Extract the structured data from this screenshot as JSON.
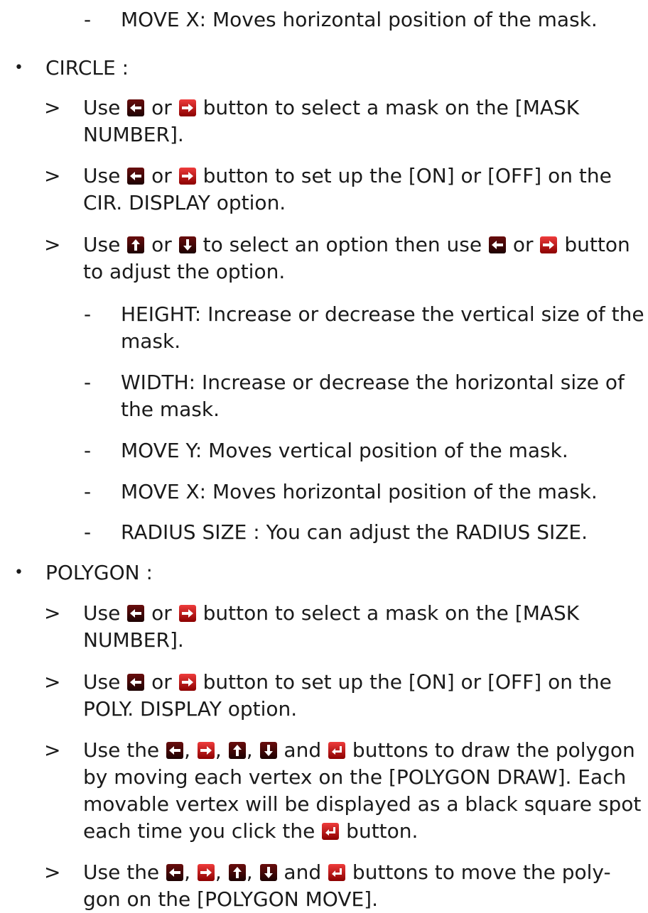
{
  "markers": {
    "bullet": "•",
    "arrow": ">",
    "dash": "-"
  },
  "lines": [
    {
      "text": "MOVE X: Moves horizontal position of the mask."
    },
    {
      "text": "CIRCLE :"
    },
    {
      "text": "button to select a mask on the [MASK"
    },
    {
      "text": "NUMBER]."
    },
    {
      "text": "button to set up the [ON] or [OFF] on the"
    },
    {
      "text": "CIR. DISPLAY option."
    },
    {
      "text": "to select an option then use"
    },
    {
      "text": "button"
    },
    {
      "text": "to adjust the option."
    },
    {
      "text": "HEIGHT: Increase or decrease the vertical size of the"
    },
    {
      "text": "mask."
    },
    {
      "text": "WIDTH: Increase or decrease the horizontal size of"
    },
    {
      "text": "the mask."
    },
    {
      "text": "MOVE Y: Moves vertical position of the mask."
    },
    {
      "text": "MOVE X: Moves horizontal position of the mask."
    },
    {
      "text": "RADIUS SIZE : You can adjust the RADIUS SIZE."
    },
    {
      "text": "POLYGON :"
    },
    {
      "text": "button to select a mask on the [MASK"
    },
    {
      "text": "NUMBER]."
    },
    {
      "text": "button to set up the [ON] or [OFF] on the"
    },
    {
      "text": "POLY. DISPLAY option."
    },
    {
      "text": "buttons to draw the polygon"
    },
    {
      "text": "by moving each vertex on the [POLYGON DRAW]. Each"
    },
    {
      "text": "movable vertex will be displayed as a black square spot"
    },
    {
      "text": "each time you click the"
    },
    {
      "text": "button."
    },
    {
      "text": "buttons to move the poly-"
    },
    {
      "text": "gon on the [POLYGON MOVE]."
    }
  ],
  "words": {
    "use": "Use",
    "use_the": "Use the",
    "or": "or",
    "and": "and",
    "comma": ","
  },
  "icons": {
    "left": "left-arrow-button-icon",
    "right": "right-arrow-button-icon",
    "up": "up-arrow-button-icon",
    "down": "down-arrow-button-icon",
    "enter": "enter-button-icon"
  },
  "colors": {
    "text": "#1a1a1a",
    "icon_dark": "#3a0606",
    "icon_red": "#d42020",
    "glyph": "#ffffff"
  }
}
